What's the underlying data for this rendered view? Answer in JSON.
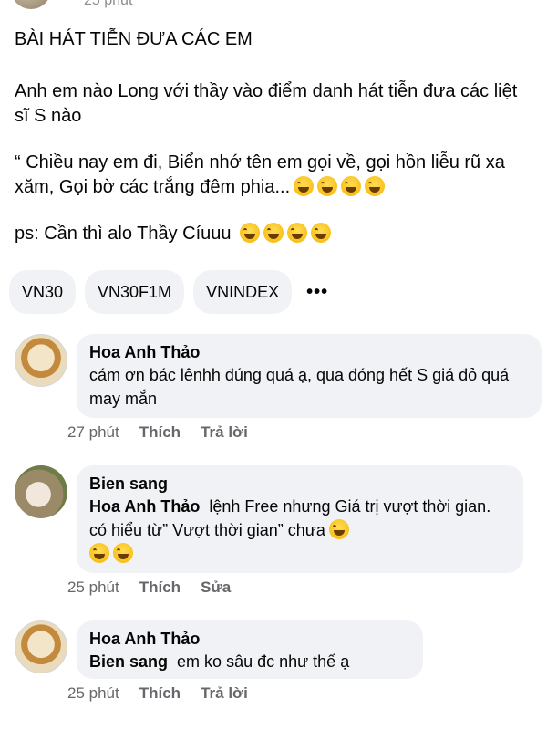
{
  "header": {
    "time": "25 phút"
  },
  "post": {
    "title": "BÀI HÁT TIỄN ĐƯA CÁC EM",
    "line1": "Anh em nào Long với thầy vào điểm danh hát tiễn đưa các liệt sĩ S nào",
    "line2": "“ Chiều nay em đi, Biển nhớ tên em gọi về, gọi hồn liễu rũ xa xăm, Gọi bờ các trắng đêm phia...",
    "line3": "ps: Cần thì alo Thầy Cíuuu"
  },
  "tags": [
    "VN30",
    "VN30F1M",
    "VNINDEX"
  ],
  "more_label": "•••",
  "comments": [
    {
      "author": "Hoa Anh Thảo",
      "text": "cám ơn bác lênhh đúng quá ạ, qua đóng hết S giá đỏ quá may mắn",
      "time": "27 phút",
      "like": "Thích",
      "action": "Trả lời"
    },
    {
      "author": "Bien sang",
      "mention": "Hoa Anh Thảo",
      "text": "lệnh Free nhưng Giá trị vượt thời gian. có hiểu từ” Vượt thời gian” chưa",
      "time": "25 phút",
      "like": "Thích",
      "action": "Sửa"
    },
    {
      "author": "Hoa Anh Thảo",
      "mention": "Bien sang",
      "text": "em ko sâu đc như thế ạ",
      "time": "25 phút",
      "like": "Thích",
      "action": "Trả lời"
    }
  ],
  "icons": {
    "emoji": "grinning-squinting-face-icon"
  }
}
